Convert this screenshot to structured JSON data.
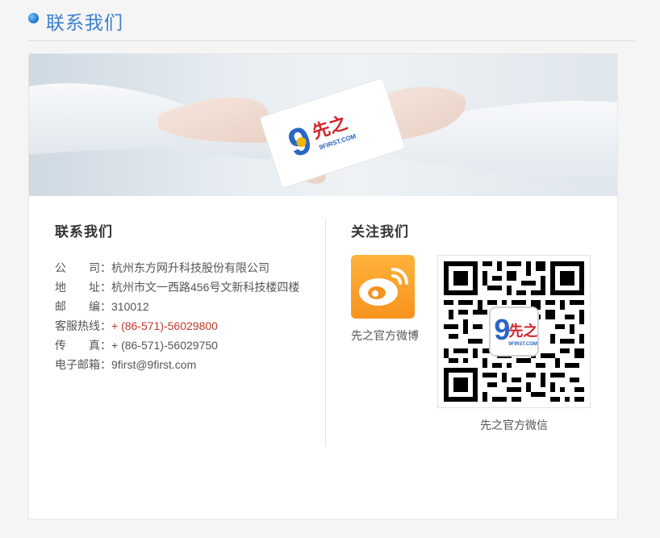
{
  "page": {
    "title": "联系我们"
  },
  "banner": {
    "logo_text": "先之",
    "logo_subtext": "9FIRST.COM"
  },
  "contact": {
    "heading": "联系我们",
    "rows": [
      {
        "label": "公　　司：",
        "value": "杭州东方网升科技股份有限公司"
      },
      {
        "label": "地　　址：",
        "value": "杭州市文一西路456号文新科技楼四楼"
      },
      {
        "label": "邮　　编：",
        "value": "310012"
      },
      {
        "label": "客服热线：",
        "value": "+ (86-571)-56029800"
      },
      {
        "label": "传　　真：",
        "value": "+ (86-571)-56029750"
      },
      {
        "label": "电子邮箱：",
        "value": "9first@9first.com"
      }
    ],
    "hotline_color": "#c0392b"
  },
  "follow": {
    "heading": "关注我们",
    "weibo_caption": "先之官方微博",
    "wechat_caption": "先之官方微信",
    "qr_logo_text": "先之",
    "qr_logo_subtext": "9FIRST.COM"
  },
  "colors": {
    "accent": "#3b7fcf",
    "weibo": "#f7931e"
  }
}
